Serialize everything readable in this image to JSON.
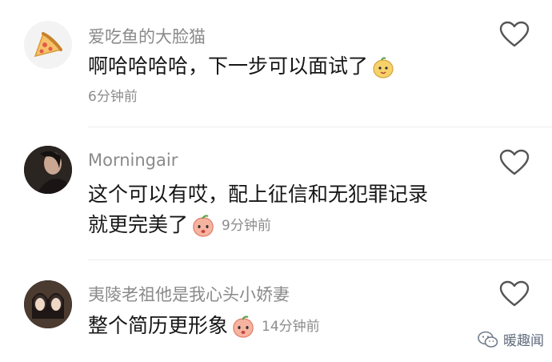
{
  "comments": [
    {
      "username": "爱吃鱼的大脸猫",
      "line1": "啊哈哈哈哈，下一步可以面试了",
      "line2": "",
      "time": "6分钟前",
      "avatar_icon": "pizza-icon",
      "emoji_icon": "cute-fruit-emoji-icon"
    },
    {
      "username": "Morningair",
      "line1": "这个可以有哎，配上征信和无犯罪记录",
      "line2": "就更完美了",
      "time": "9分钟前",
      "avatar_icon": "dark-portrait-avatar",
      "emoji_icon": "peach-emoji-icon"
    },
    {
      "username": "夷陵老祖他是我心头小娇妻",
      "line1": "整个简历更形象",
      "line2": "",
      "time": "14分钟前",
      "avatar_icon": "two-people-avatar",
      "emoji_icon": "peach-emoji-icon"
    }
  ],
  "watermark": {
    "label": "暖趣闻",
    "icon": "wechat-icon"
  }
}
